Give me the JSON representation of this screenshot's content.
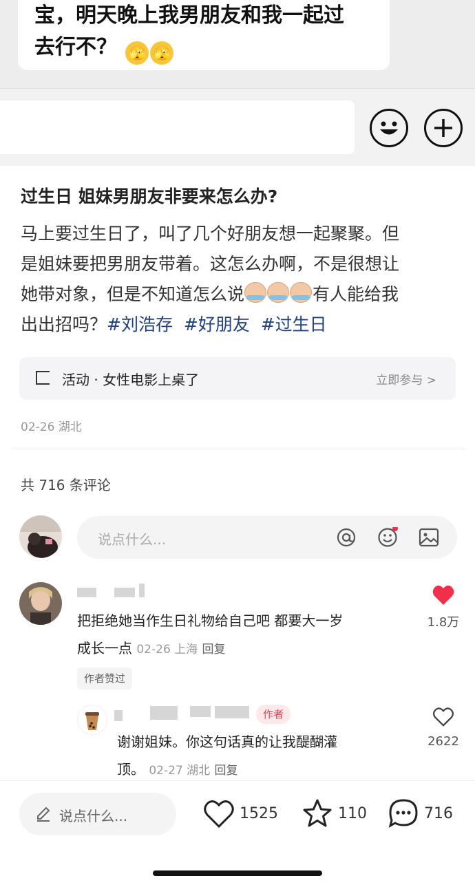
{
  "chat": {
    "line1": "宝，明天晚上我男朋友和我一起过",
    "line2": "去行不？",
    "emojis": [
      "🫣",
      "🫣"
    ],
    "icons": [
      "smiley-icon",
      "plus-icon"
    ]
  },
  "post": {
    "title": "过生日 姐妹男朋友非要来怎么办?",
    "body_1": "马上要过生日了，叫了几个好朋友想一起聚聚。但",
    "body_2": "是姐妹要把男朋友带着。这怎么办啊，不是很想让",
    "body_3a": "她带对象，但是不知道怎么说",
    "body_3b": "有人能给我",
    "body_4": "出出招吗？",
    "tags": [
      "#刘浩存",
      "#好朋友",
      "#过生日"
    ],
    "activity_label": "活动 · 女性电影上桌了",
    "activity_join": "立即参与 >",
    "date_location": "02-26 湖北"
  },
  "comments": {
    "count_label": "共 716 条评论",
    "input_placeholder": "说点什么...",
    "items": [
      {
        "text_1": "把拒绝她当作生日礼物给自己吧 都要大一岁",
        "text_2": "成长一点",
        "meta": "02-26 上海",
        "reply": "回复",
        "badge": "作者赞过",
        "likes": "1.8万",
        "liked": true
      }
    ],
    "reply": {
      "author_tag": "作者",
      "text_1": "谢谢姐妹。你这句话真的让我醍醐灌",
      "text_2": "顶。",
      "meta": "02-27 湖北",
      "reply": "回复",
      "likes": "2622"
    }
  },
  "bottom_bar": {
    "placeholder": "说点什么...",
    "likes": "1525",
    "stars": "110",
    "comments": "716"
  },
  "colors": {
    "tag": "#21427a",
    "like_red": "#f0304a",
    "author_tag": "#e0455a"
  }
}
